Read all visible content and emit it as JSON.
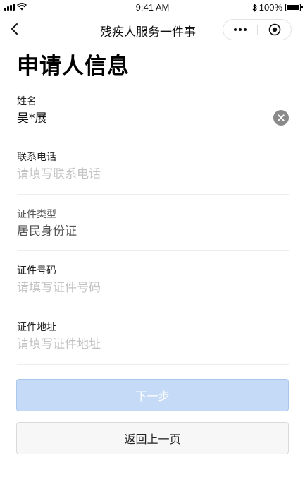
{
  "status_bar": {
    "time": "9:41 AM",
    "battery_text": "100%",
    "icons": [
      "signal-icon",
      "wifi-icon",
      "bluetooth-icon",
      "battery-icon"
    ]
  },
  "nav": {
    "title": "残疾人服务一件事",
    "icons": [
      "back-icon",
      "more-icon",
      "target-icon"
    ]
  },
  "page": {
    "title": "申请人信息"
  },
  "form": {
    "name": {
      "label": "姓名",
      "value": "吴*展"
    },
    "phone": {
      "label": "联系电话",
      "placeholder": "请填写联系电话"
    },
    "id_type": {
      "label": "证件类型",
      "value": "居民身份证"
    },
    "id_number": {
      "label": "证件号码",
      "placeholder": "请填写证件号码"
    },
    "id_address": {
      "label": "证件地址",
      "placeholder": "请填写证件地址"
    }
  },
  "actions": {
    "next_label": "下一步",
    "back_label": "返回上一页"
  },
  "colors": {
    "primary_disabled": "#c4daf6",
    "placeholder": "#c2c2c2",
    "divider": "#ededed"
  }
}
